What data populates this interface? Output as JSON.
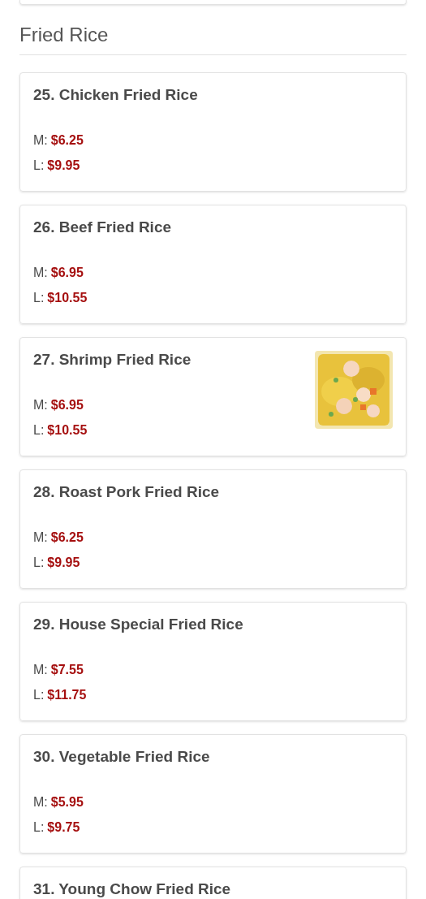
{
  "section": {
    "title": "Fried Rice"
  },
  "items": [
    {
      "name": "25. Chicken Fried Rice",
      "prices": [
        {
          "size": "M:",
          "price": "$6.25"
        },
        {
          "size": "L:",
          "price": "$9.95"
        }
      ]
    },
    {
      "name": "26. Beef Fried Rice",
      "prices": [
        {
          "size": "M:",
          "price": "$6.95"
        },
        {
          "size": "L:",
          "price": "$10.55"
        }
      ]
    },
    {
      "name": "27. Shrimp Fried Rice",
      "prices": [
        {
          "size": "M:",
          "price": "$6.95"
        },
        {
          "size": "L:",
          "price": "$10.55"
        }
      ]
    },
    {
      "name": "28. Roast Pork Fried Rice",
      "prices": [
        {
          "size": "M:",
          "price": "$6.25"
        },
        {
          "size": "L:",
          "price": "$9.95"
        }
      ]
    },
    {
      "name": "29. House Special Fried Rice",
      "prices": [
        {
          "size": "M:",
          "price": "$7.55"
        },
        {
          "size": "L:",
          "price": "$11.75"
        }
      ]
    },
    {
      "name": "30. Vegetable Fried Rice",
      "prices": [
        {
          "size": "M:",
          "price": "$5.95"
        },
        {
          "size": "L:",
          "price": "$9.75"
        }
      ]
    },
    {
      "name": "31. Young Chow Fried Rice"
    }
  ]
}
